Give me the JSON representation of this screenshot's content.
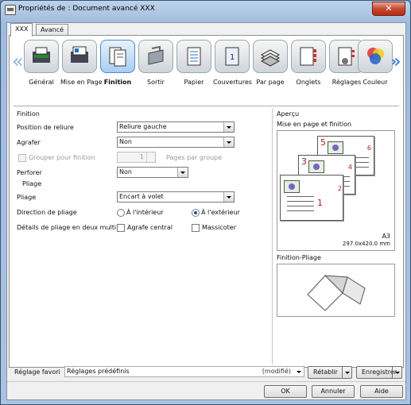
{
  "window": {
    "title": "Propriétés de : Document avancé XXX",
    "close_glyph": "✕"
  },
  "tabs": [
    "XXX",
    "Avancé"
  ],
  "categories": [
    {
      "label": "Général",
      "icon": "general-icon"
    },
    {
      "label": "Mise en Page",
      "icon": "layout-icon"
    },
    {
      "label": "Finition",
      "icon": "finishing-icon",
      "selected": true
    },
    {
      "label": "Sortir",
      "icon": "output-icon"
    },
    {
      "label": "Papier",
      "icon": "paper-icon"
    },
    {
      "label": "Couvertures",
      "icon": "covers-icon"
    },
    {
      "label": "Par page",
      "icon": "per-page-icon"
    },
    {
      "label": "Onglets",
      "icon": "tabs-icon"
    },
    {
      "label": "Réglages",
      "icon": "settings-icon"
    },
    {
      "label": "Couleur",
      "icon": "color-icon"
    }
  ],
  "nav": {
    "prev": "«",
    "next": "»"
  },
  "finition": {
    "group_label": "Finition",
    "binding_position": {
      "label": "Position de reliure",
      "value": "Reliure gauche"
    },
    "staple": {
      "label": "Agrafer",
      "value": "Non"
    },
    "group_for_finishing": {
      "label": "Grouper pour finition",
      "value": "1",
      "unit": "Pages par groupe"
    },
    "punch": {
      "label": "Perforer",
      "value": "Non"
    }
  },
  "pliage": {
    "group_label": "Pliage",
    "fold": {
      "label": "Pliage",
      "value": "Encart à volet"
    },
    "direction": {
      "label": "Direction de pliage",
      "inside": "À l'intérieur",
      "outside": "À l'extérieur",
      "selected": "outside"
    },
    "details": {
      "label": "Détails de pliage en deux multi",
      "center_staple": "Agrafe central",
      "trim": "Massicoter"
    }
  },
  "apercu": {
    "group_label": "Aperçu",
    "layout_label": "Mise en page et finition",
    "paper_size": "A3",
    "paper_dims": "297.0x420.0 mm",
    "pages": [
      "5",
      "6",
      "3",
      "4",
      "1",
      "2"
    ],
    "fold_label": "Finition-Pliage"
  },
  "favorites": {
    "label": "Réglage favori",
    "value": "Réglages prédéfinis",
    "modified": "(modifié)",
    "reset_label": "Rétablir",
    "save_label": "Enregistrer"
  },
  "buttons": {
    "ok": "OK",
    "cancel": "Annuler",
    "help": "Aide"
  }
}
